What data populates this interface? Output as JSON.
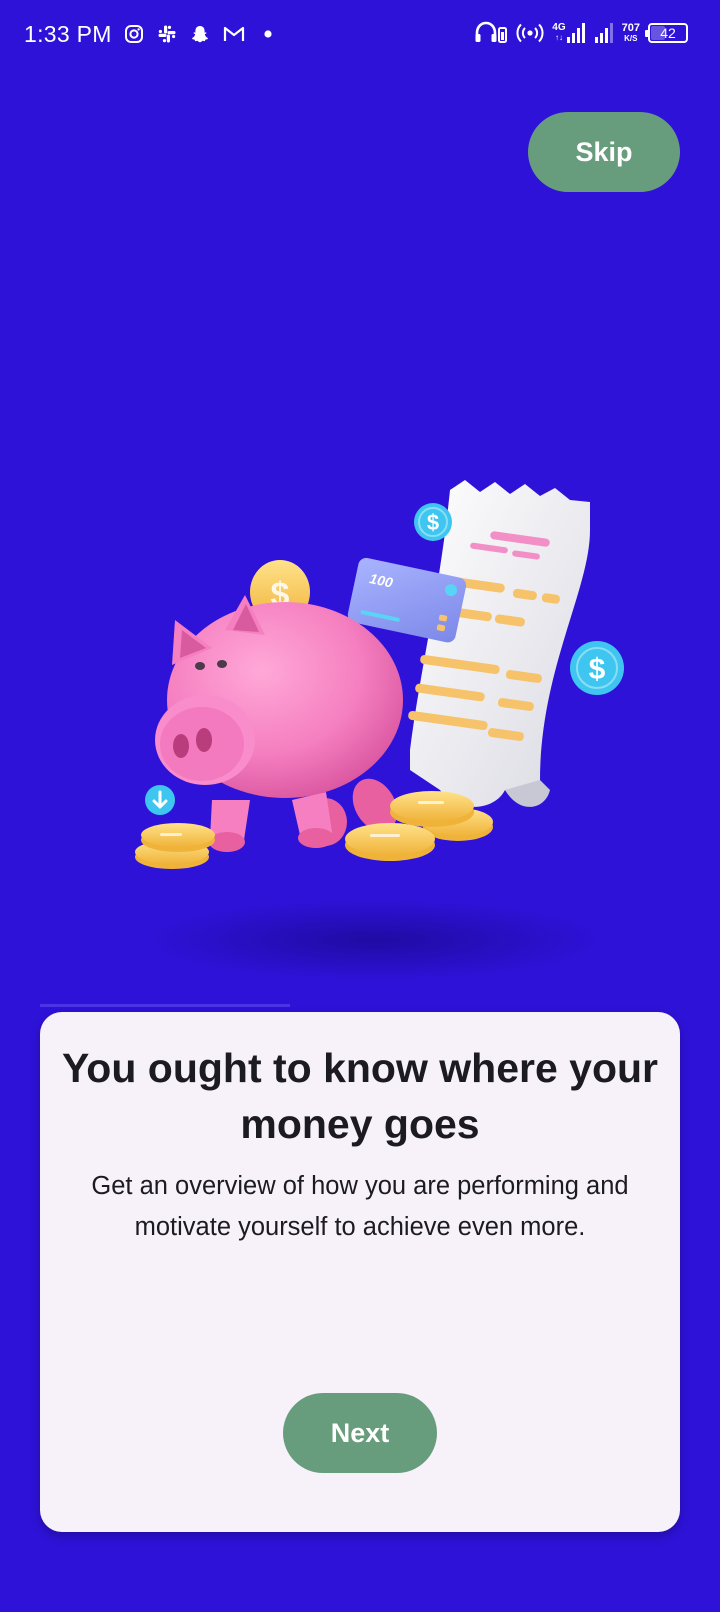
{
  "status_bar": {
    "time": "1:33 PM",
    "network_type": "4G",
    "network_sub": "↑↓",
    "speed_value": "707",
    "speed_unit": "K/S",
    "battery_level": "42",
    "battery_fraction": 0.42,
    "left_icons": [
      "instagram-icon",
      "slack-icon",
      "snapchat-icon",
      "gmail-icon",
      "notification-dot-icon"
    ],
    "right_icons": [
      "headset-icon",
      "hotspot-icon",
      "signal-icon",
      "signal-weak-icon",
      "battery-icon"
    ]
  },
  "onboarding": {
    "skip_label": "Skip",
    "title": "You ought to know where your money goes",
    "description": "Get an overview of how you are performing and motivate yourself to achieve even more.",
    "next_label": "Next",
    "illustration": {
      "card_text": "100"
    }
  },
  "colors": {
    "background": "#2e12d8",
    "button": "#679d7c",
    "card": "#f7f2fa",
    "text": "#1c1b1f",
    "piggy": "#f57fc0",
    "coin": "#f9c85a",
    "dollar_badge": "#3ec6f0"
  }
}
